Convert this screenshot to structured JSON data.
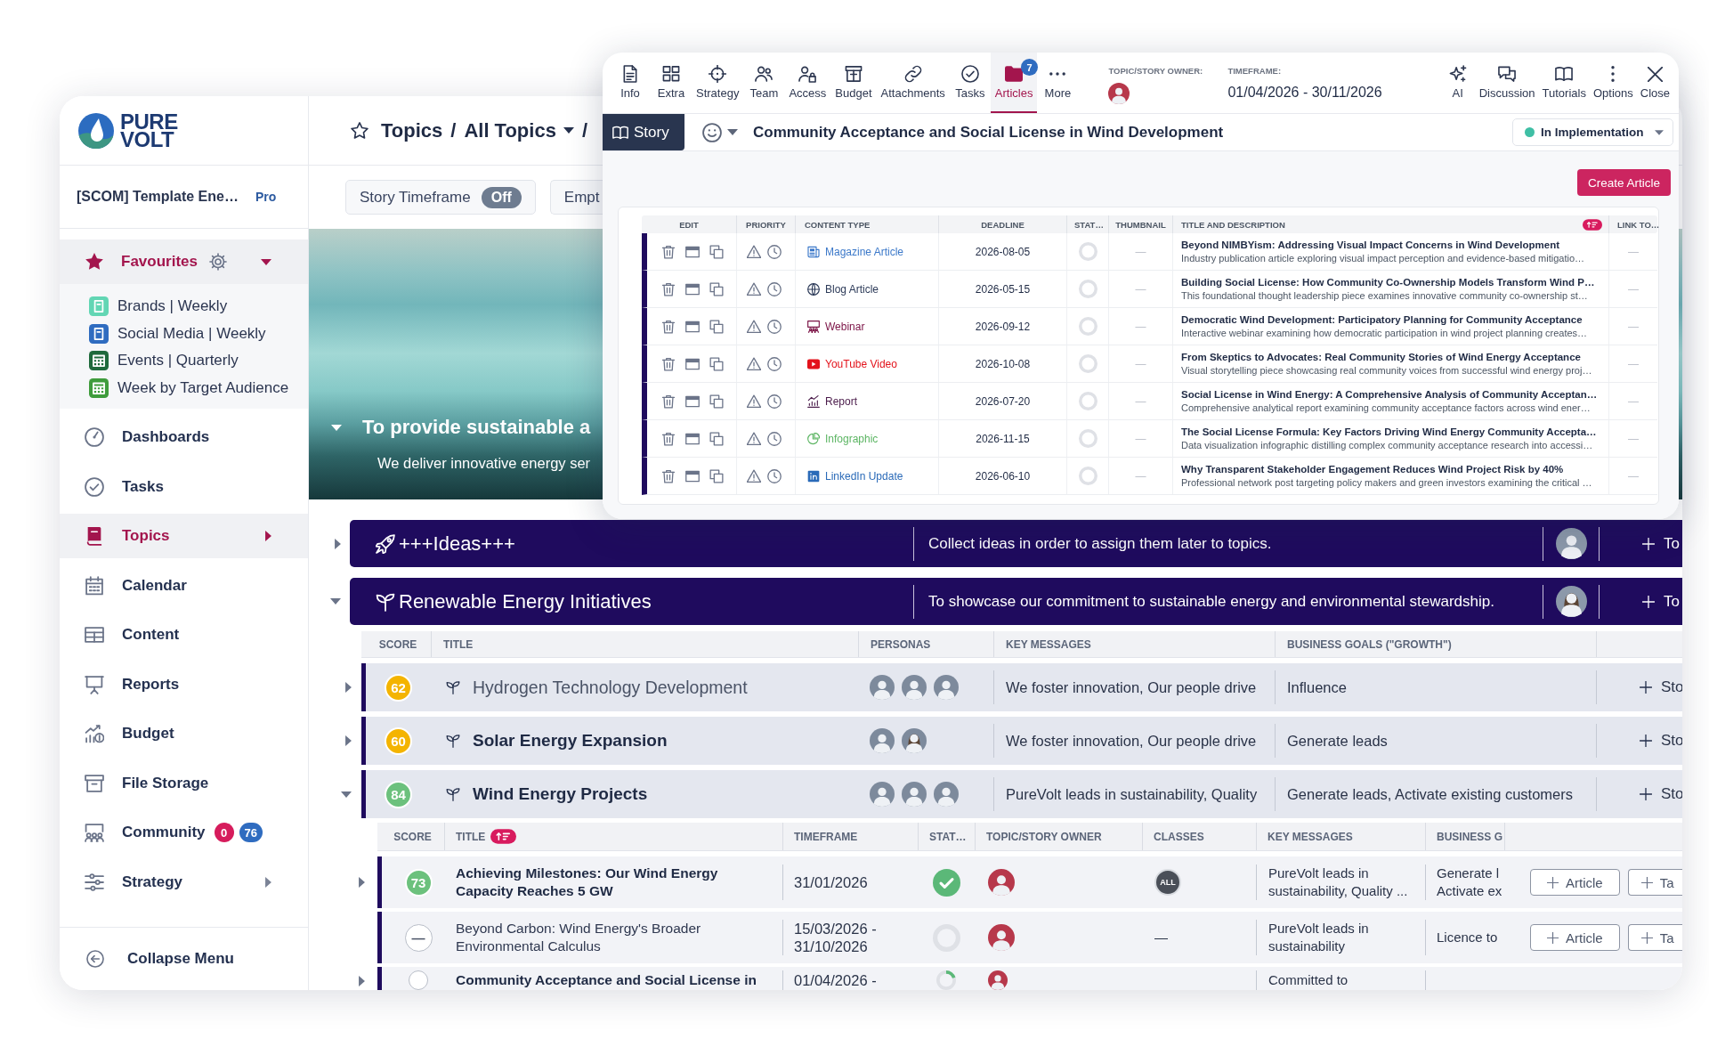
{
  "sidebar": {
    "logo": {
      "lines": [
        "PURE",
        "VOLT"
      ]
    },
    "workspace": {
      "name": "[SCOM] Template Ene…",
      "plan": "Pro"
    },
    "favourites": {
      "label": "Favourites",
      "expanded": true,
      "items": [
        {
          "label": "Brands | Weekly",
          "color": "#62d6b4"
        },
        {
          "label": "Social Media | Weekly",
          "color": "#2f6cc0"
        },
        {
          "label": "Events | Quarterly",
          "color": "#1f6a3c"
        },
        {
          "label": "Week by Target Audience",
          "color": "#3f9c3c"
        }
      ]
    },
    "items": [
      {
        "label": "Dashboards",
        "selected": false,
        "expandable": false
      },
      {
        "label": "Tasks",
        "selected": false,
        "expandable": false
      },
      {
        "label": "Topics",
        "selected": true,
        "expandable": true
      },
      {
        "label": "Calendar",
        "selected": false,
        "expandable": false
      },
      {
        "label": "Content",
        "selected": false,
        "expandable": false
      },
      {
        "label": "Reports",
        "selected": false,
        "expandable": false
      },
      {
        "label": "Budget",
        "selected": false,
        "expandable": false
      },
      {
        "label": "File Storage",
        "selected": false,
        "expandable": false
      },
      {
        "label": "Community",
        "selected": false,
        "expandable": false,
        "badges": [
          {
            "text": "0",
            "color": "#d61c5c"
          },
          {
            "text": "76",
            "color": "#2f6cc0"
          }
        ]
      },
      {
        "label": "Strategy",
        "selected": false,
        "expandable": true
      }
    ],
    "collapse": {
      "label": "Collapse Menu"
    }
  },
  "header": {
    "starred": false,
    "breadcrumb": [
      {
        "label": "Topics",
        "kind": "link"
      },
      {
        "label": "/",
        "kind": "separator"
      },
      {
        "label": "All Topics",
        "kind": "dropdown"
      },
      {
        "label": "/",
        "kind": "separator"
      }
    ]
  },
  "filters": [
    {
      "label": "Story Timeframe",
      "toggle": "Off",
      "on": false
    },
    {
      "label": "Empt"
    }
  ],
  "hero": {
    "expanded": true,
    "title": "To provide sustainable a",
    "subtitle": "We deliver innovative energy ser"
  },
  "topic_groups": [
    {
      "title": "+++Ideas+++",
      "description": "Collect ideas in order to assign them later to topics.",
      "expanded": false,
      "owner": {
        "kind": "man"
      },
      "add_label": "To"
    },
    {
      "title": "Renewable Energy Initiatives",
      "description": "To showcase our commitment to sustainable energy and environmental stewardship.",
      "expanded": true,
      "owner": {
        "kind": "woman"
      },
      "add_label": "To",
      "columns": [
        "SCORE",
        "TITLE",
        "PERSONAS",
        "KEY MESSAGES",
        "BUSINESS GOALS (\"GROWTH\")"
      ],
      "topics": [
        {
          "score": {
            "value": "62",
            "color": "#f4b400"
          },
          "title": "Hydrogen Technology Development",
          "muted": true,
          "expanded": false,
          "personas": [
            {
              "kind": "man"
            },
            {
              "kind": "man"
            },
            {
              "kind": "man"
            }
          ],
          "key_messages": "We foster innovation, Our people drive",
          "business_goals": "Influence",
          "add_label": "Sto"
        },
        {
          "score": {
            "value": "60",
            "color": "#f4b400"
          },
          "title": "Solar Energy Expansion",
          "muted": false,
          "expanded": false,
          "personas": [
            {
              "kind": "man"
            },
            {
              "kind": "woman"
            }
          ],
          "key_messages": "We foster innovation, Our people drive",
          "business_goals": "Generate leads",
          "add_label": "Sto"
        },
        {
          "score": {
            "value": "84",
            "color": "#6cc17d"
          },
          "title": "Wind Energy Projects",
          "muted": false,
          "expanded": true,
          "personas": [
            {
              "kind": "man"
            },
            {
              "kind": "man"
            },
            {
              "kind": "man"
            }
          ],
          "key_messages": "PureVolt leads in sustainability, Quality",
          "business_goals": "Generate leads, Activate existing customers",
          "add_label": "Sto",
          "story_columns": [
            {
              "label": "SCORE",
              "sorted": false
            },
            {
              "label": "TITLE",
              "sorted": true
            },
            {
              "label": "TIMEFRAME",
              "sorted": false
            },
            {
              "label": "STAT…",
              "sorted": false
            },
            {
              "label": "TOPIC/STORY OWNER",
              "sorted": false
            },
            {
              "label": "CLASSES",
              "sorted": false
            },
            {
              "label": "KEY MESSAGES",
              "sorted": false
            },
            {
              "label": "BUSINESS G",
              "sorted": false
            }
          ],
          "stories": [
            {
              "has_children": true,
              "score": {
                "value": "73",
                "color": "#6cc17d"
              },
              "title": "Achieving Milestones: Our Wind Energy Capacity Reaches 5 GW",
              "muted": false,
              "timeframe": "31/01/2026",
              "status": {
                "complete": true,
                "in_progress": false
              },
              "owner": {
                "kind": "man"
              },
              "classes": {
                "text": "ALL",
                "kind": "badge"
              },
              "key_messages": "PureVolt leads in sustainability, Quality ...",
              "business_goals": "Generate l Activate ex",
              "buttons": [
                "Article",
                "Ta"
              ]
            },
            {
              "has_children": false,
              "score": {
                "value": "—"
              },
              "title": "Beyond Carbon: Wind Energy's Broader Environmental Calculus",
              "muted": true,
              "timeframe": "15/03/2026 - 31/10/2026",
              "status": {
                "complete": false,
                "in_progress": false
              },
              "owner": {
                "kind": "man"
              },
              "classes": {
                "text": "—",
                "kind": "plain"
              },
              "key_messages": "PureVolt leads in sustainability",
              "business_goals": "Licence to",
              "buttons": [
                "Article",
                "Ta"
              ]
            },
            {
              "has_children": true,
              "title": "Community Acceptance and Social License in",
              "muted": false,
              "timeframe": "01/04/2026 -",
              "status": {
                "complete": false,
                "in_progress": true
              },
              "owner": {
                "kind": "man"
              },
              "key_messages": "Committed to"
            }
          ]
        }
      ]
    }
  ],
  "story_window": {
    "toolbar": [
      {
        "label": "Info",
        "selected": false
      },
      {
        "label": "Extra",
        "selected": false
      },
      {
        "label": "Strategy",
        "selected": false
      },
      {
        "label": "Team",
        "selected": false
      },
      {
        "label": "Access",
        "selected": false
      },
      {
        "label": "Budget",
        "selected": false
      },
      {
        "label": "Attachments",
        "selected": false
      },
      {
        "label": "Tasks",
        "selected": false
      },
      {
        "label": "Articles",
        "selected": true,
        "badge": "7"
      },
      {
        "label": "More",
        "selected": false
      }
    ],
    "owner_label": "TOPIC/STORY OWNER:",
    "owner": {
      "kind": "man"
    },
    "timeframe_label": "TIMEFRAME:",
    "timeframe": "01/04/2026 - 30/11/2026",
    "actions": [
      {
        "label": "AI"
      },
      {
        "label": "Discussion"
      },
      {
        "label": "Tutorials"
      },
      {
        "label": "Options"
      },
      {
        "label": "Close"
      }
    ],
    "story_tab": {
      "label": "Story",
      "selected": true
    },
    "title": "Community Acceptance and Social License in Wind Development",
    "status": {
      "label": "In Implementation",
      "color": "#3fbfa5"
    },
    "create_button": "Create Article",
    "articles": {
      "columns": [
        {
          "label": "EDIT",
          "sorted": false
        },
        {
          "label": "PRIORITY",
          "sorted": false
        },
        {
          "label": "CONTENT TYPE",
          "sorted": false
        },
        {
          "label": "DEADLINE",
          "sorted": false
        },
        {
          "label": "STAT…",
          "sorted": false
        },
        {
          "label": "THUMBNAIL",
          "sorted": false
        },
        {
          "label": "TITLE AND DESCRIPTION",
          "sorted": true
        },
        {
          "label": "LINK TO…",
          "sorted": false
        }
      ],
      "rows": [
        {
          "content_type": "Magazine Article",
          "color": "#3b78c9",
          "deadline": "2026-08-05",
          "status": {
            "complete": false,
            "in_progress": false
          },
          "thumbnail": "—",
          "title": "Beyond NIMBYism: Addressing Visual Impact Concerns in Wind Development",
          "description": "Industry publication article exploring visual impact perception and evidence-based mitigatio…",
          "link": "—"
        },
        {
          "content_type": "Blog Article",
          "color": "#2c3a58",
          "deadline": "2026-05-15",
          "status": {
            "complete": false,
            "in_progress": false
          },
          "thumbnail": "—",
          "title": "Building Social License: How Community Co-Ownership Models Transform Wind P…",
          "description": "This foundational thought leadership piece examines innovative community co-ownership st…",
          "link": "—"
        },
        {
          "content_type": "Webinar",
          "color": "#7b1245",
          "deadline": "2026-09-12",
          "status": {
            "complete": false,
            "in_progress": false
          },
          "thumbnail": "—",
          "title": "Democratic Wind Development: Participatory Planning for Community Acceptance",
          "description": "Interactive webinar examining how democratic participation in wind project planning creates…",
          "link": "—"
        },
        {
          "content_type": "YouTube Video",
          "color": "#e3121b",
          "deadline": "2026-10-08",
          "status": {
            "complete": false,
            "in_progress": false
          },
          "thumbnail": "—",
          "title": "From Skeptics to Advocates: Real Community Stories of Wind Energy Acceptance",
          "description": "Visual storytelling piece showcasing real community voices from successful wind energy proj…",
          "link": "—"
        },
        {
          "content_type": "Report",
          "color": "#4b1c4b",
          "deadline": "2026-07-20",
          "status": {
            "complete": false,
            "in_progress": false
          },
          "thumbnail": "—",
          "title": "Social License in Wind Energy: A Comprehensive Analysis of Community Acceptan…",
          "description": "Comprehensive analytical report examining community acceptance factors across wind ener…",
          "link": "—"
        },
        {
          "content_type": "Infographic",
          "color": "#5cb563",
          "deadline": "2026-11-15",
          "status": {
            "complete": false,
            "in_progress": false
          },
          "thumbnail": "—",
          "title": "The Social License Formula: Key Factors Driving Wind Energy Community Accepta…",
          "description": "Data visualization infographic distilling complex community acceptance research into accessi…",
          "link": "—"
        },
        {
          "content_type": "LinkedIn Update",
          "color": "#2a6ab8",
          "deadline": "2026-06-10",
          "status": {
            "complete": false,
            "in_progress": false
          },
          "thumbnail": "—",
          "title": "Why Transparent Stakeholder Engagement Reduces Wind Project Risk by 40%",
          "description": "Professional network post targeting policy makers and green investors examining the critical …",
          "link": "—"
        }
      ]
    }
  }
}
